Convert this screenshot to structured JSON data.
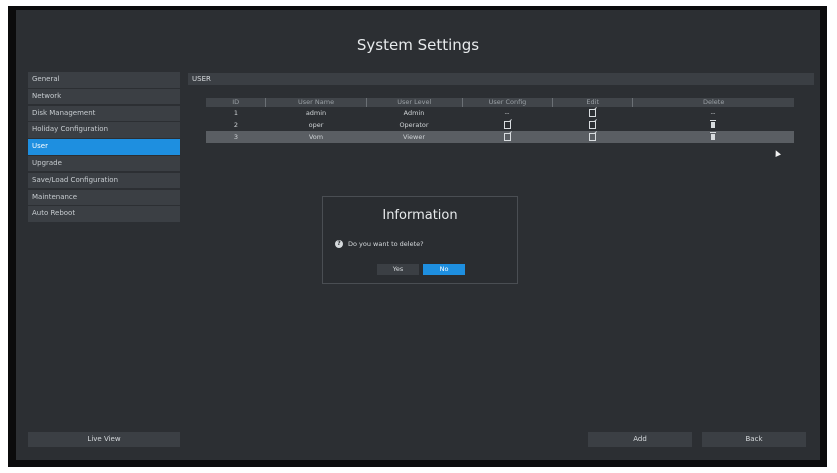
{
  "title": "System Settings",
  "sidebar": {
    "items": [
      {
        "label": "General",
        "active": false
      },
      {
        "label": "Network",
        "active": false
      },
      {
        "label": "Disk Management",
        "active": false
      },
      {
        "label": "Holiday Configuration",
        "active": false
      },
      {
        "label": "User",
        "active": true
      },
      {
        "label": "Upgrade",
        "active": false
      },
      {
        "label": "Save/Load Configuration",
        "active": false
      },
      {
        "label": "Maintenance",
        "active": false
      },
      {
        "label": "Auto Reboot",
        "active": false
      }
    ],
    "live_view_label": "Live View"
  },
  "section": {
    "label": "USER"
  },
  "table": {
    "headers": [
      "ID",
      "User Name",
      "User Level",
      "User Config",
      "Edit",
      "Delete"
    ],
    "rows": [
      {
        "id": "1",
        "name": "admin",
        "level": "Admin",
        "config": "--",
        "edit": "edit-icon",
        "delete": "--"
      },
      {
        "id": "2",
        "name": "oper",
        "level": "Operator",
        "config": "edit-icon",
        "edit": "edit-icon",
        "delete": "trash-icon"
      },
      {
        "id": "3",
        "name": "Vom",
        "level": "Viewer",
        "config": "edit-icon",
        "edit": "edit-icon",
        "delete": "trash-icon"
      }
    ],
    "selected_row_index": 2
  },
  "dialog": {
    "title": "Information",
    "message": "Do you want to delete?",
    "yes_label": "Yes",
    "no_label": "No"
  },
  "footer": {
    "add_label": "Add",
    "back_label": "Back"
  },
  "colors": {
    "accent": "#1e8fe0",
    "background": "#2c2f33"
  }
}
